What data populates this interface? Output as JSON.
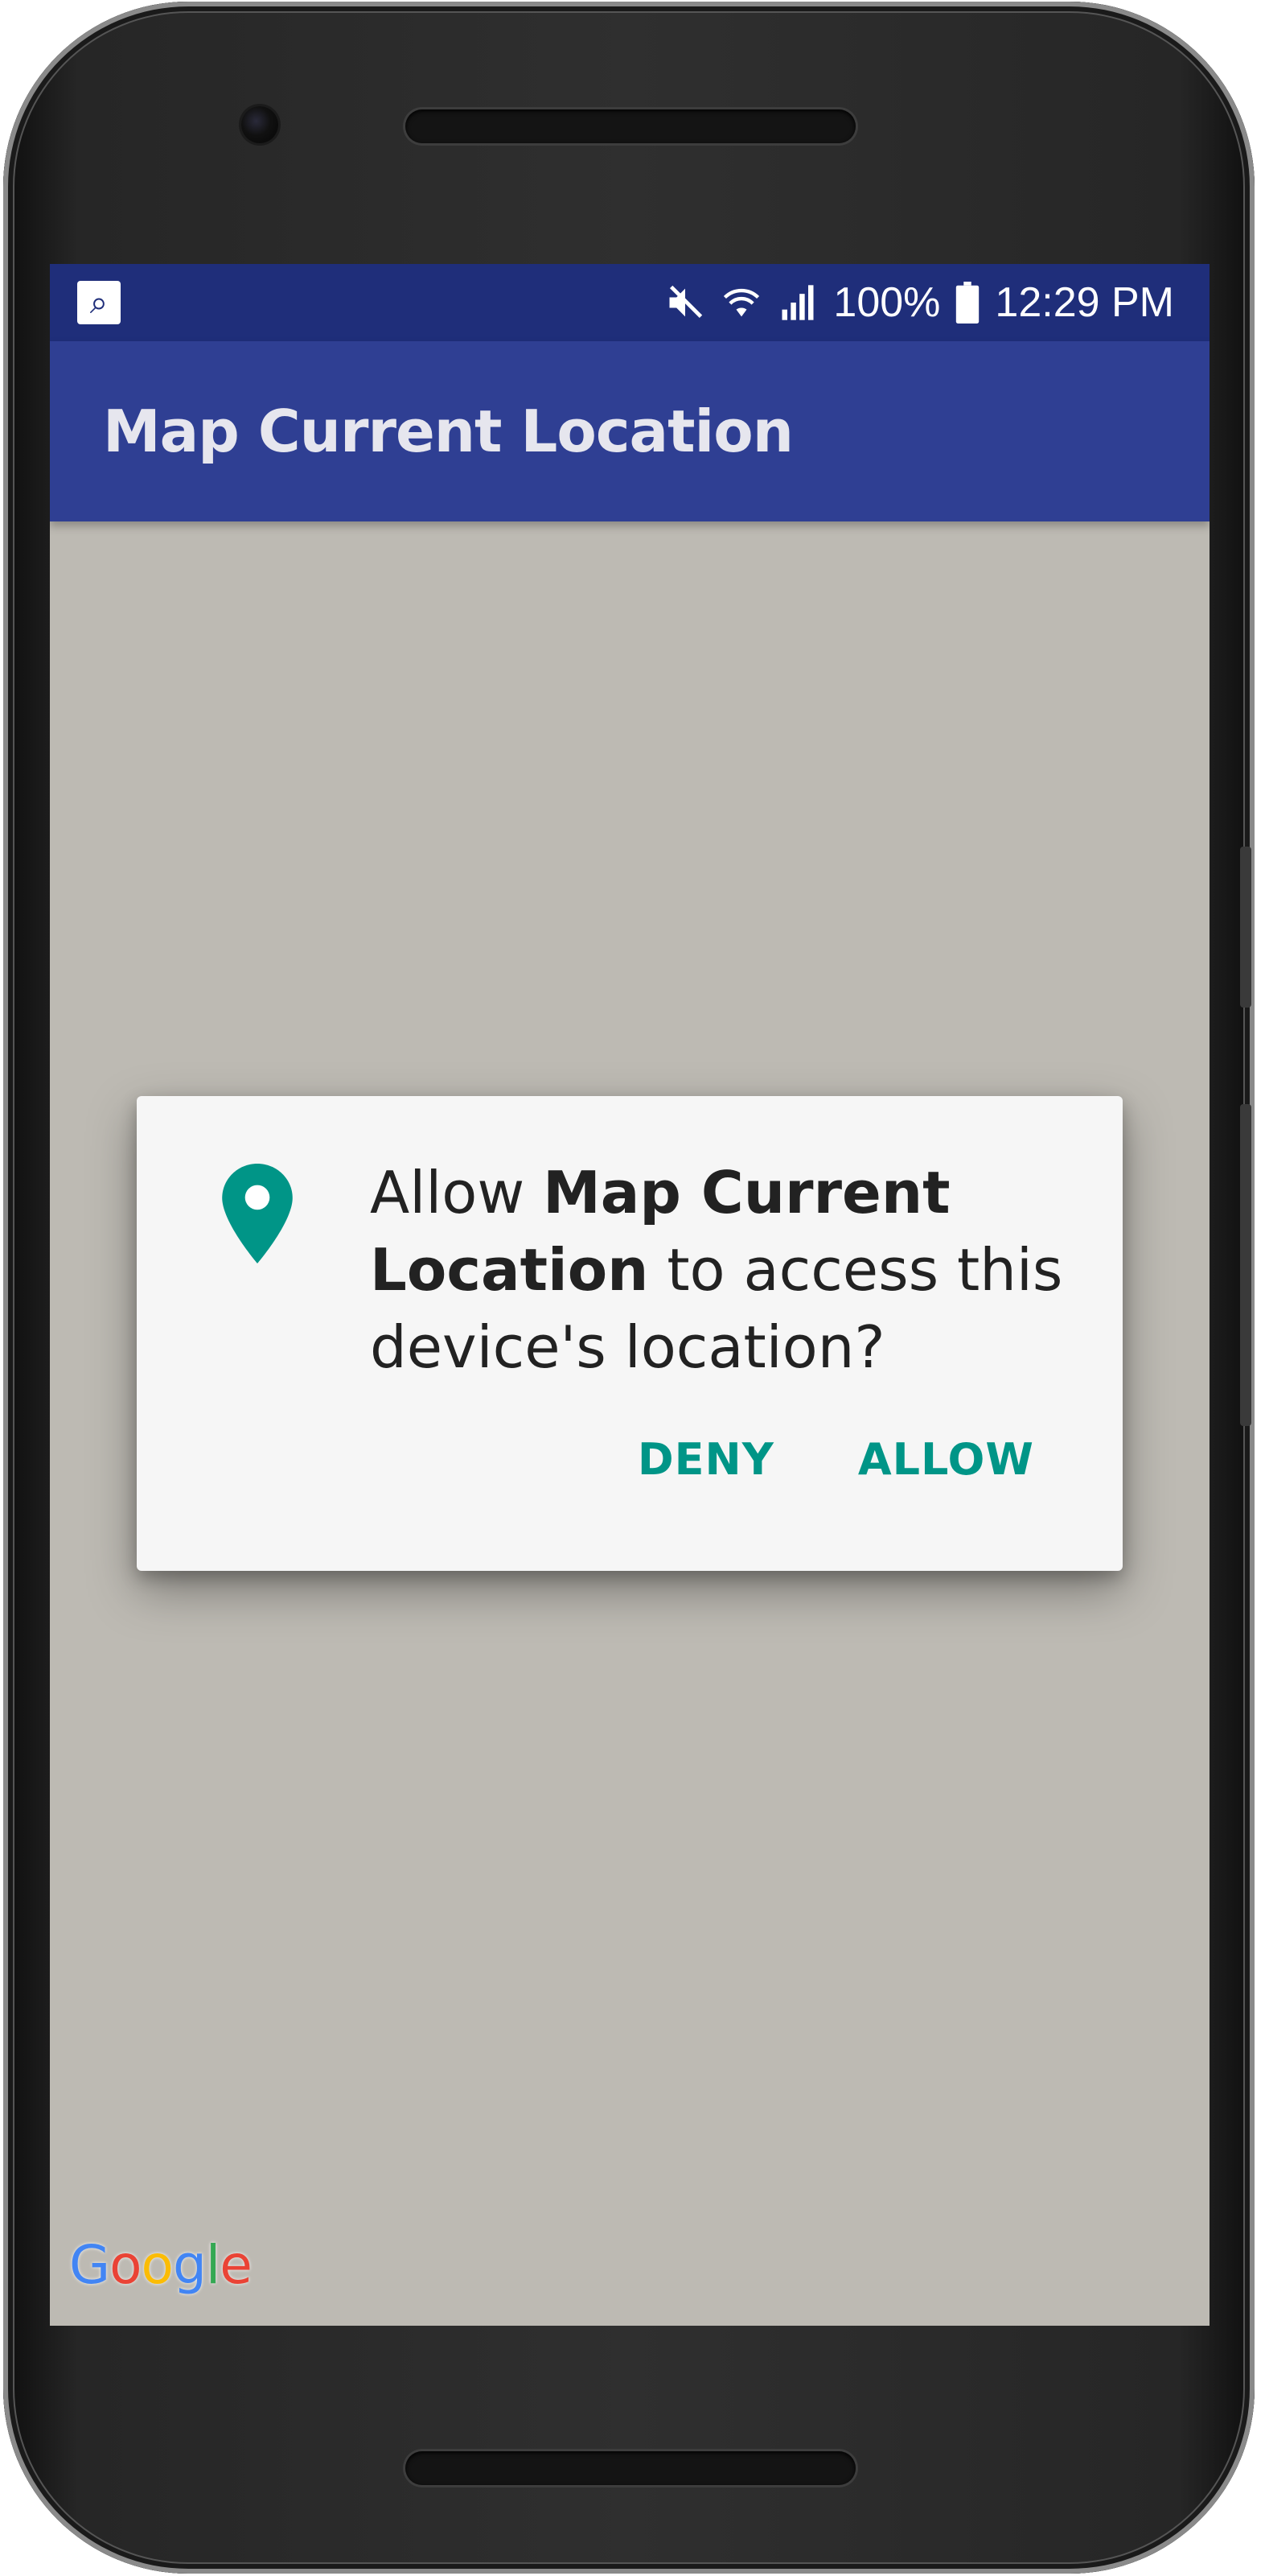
{
  "status_bar": {
    "battery": "100%",
    "time": "12:29 PM",
    "icons": [
      "notification-app-icon",
      "mute-icon",
      "wifi-icon",
      "signal-icon",
      "battery-icon"
    ]
  },
  "app_bar": {
    "title": "Map Current Location"
  },
  "permission_dialog": {
    "icon": "location-pin-icon",
    "message_prefix": "Allow ",
    "app_name": "Map Current Location",
    "message_suffix": " to access this device's location?",
    "deny_label": "DENY",
    "allow_label": "ALLOW"
  },
  "map": {
    "logo_text": "Google"
  },
  "colors": {
    "status_bar": "#1f2e7a",
    "app_bar": "#2f3f93",
    "dialog_accent": "#009587",
    "map_background": "#bdbab3"
  }
}
